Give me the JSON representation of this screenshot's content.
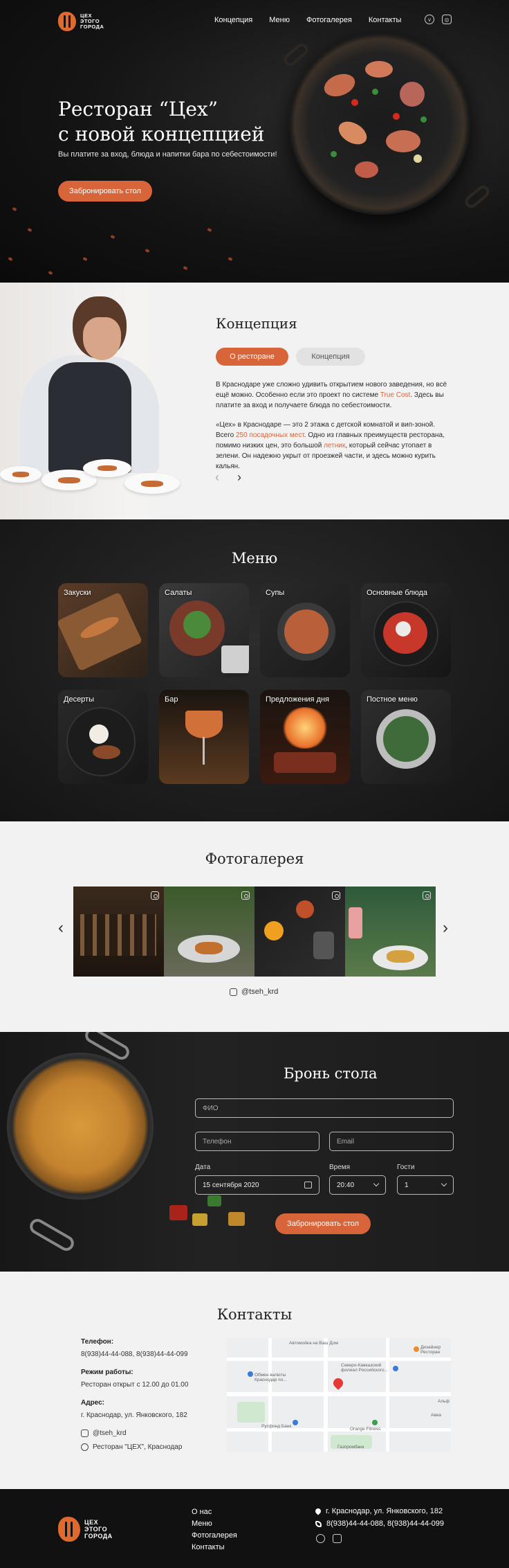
{
  "brand": {
    "logo_lines": [
      "ЦЕХ",
      "ЭТОГО",
      "ГОРОДА"
    ]
  },
  "nav": {
    "items": [
      "Концепция",
      "Меню",
      "Фотогалерея",
      "Контакты"
    ]
  },
  "social": {
    "icons": [
      "vk-icon",
      "instagram-icon"
    ]
  },
  "hero": {
    "title_line1": "Ресторан “Цех”",
    "title_line2": "с новой концепцией",
    "subtitle": "Вы платите за вход, блюда и напитки бара по себестоимости!",
    "cta": "Забронировать стол"
  },
  "concept": {
    "title": "Концепция",
    "tabs": [
      {
        "label": "О ресторане",
        "active": true
      },
      {
        "label": "Концепция",
        "active": false
      }
    ],
    "p1_a": "В Краснодаре уже сложно удивить открытием нового заведения, но всё ещё можно. Особенно если это проект по системе ",
    "p1_hl": "True Cost",
    "p1_b": ". Здесь вы платите за вход и получаете блюда по себестоимости.",
    "p2_a": "«Цех» в Краснодаре — это 2 этажа с детской комнатой и вип-зоной. Всего ",
    "p2_hl1": "250 посадочных мест",
    "p2_b": ". Одно из главных преимуществ ресторана, помимо низких цен, это большой ",
    "p2_hl2": "летник",
    "p2_c": ", который сейчас утопает в зелени. Он надежно укрыт от проезжей части, и здесь можно курить кальян.",
    "prev": "‹",
    "next": "›"
  },
  "menu": {
    "title": "Меню",
    "categories": [
      "Закуски",
      "Салаты",
      "Супы",
      "Основные блюда",
      "Десерты",
      "Бар",
      "Предложения дня",
      "Постное меню"
    ]
  },
  "gallery": {
    "title": "Фотогалерея",
    "prev": "‹",
    "next": "›",
    "handle": "@tseh_krd"
  },
  "booking": {
    "title": "Бронь стола",
    "name_placeholder": "ФИО",
    "phone_placeholder": "Телефон",
    "email_placeholder": "Email",
    "date_label": "Дата",
    "time_label": "Время",
    "guests_label": "Гости",
    "date_value": "15 сентября 2020",
    "time_value": "20:40",
    "guests_value": "1",
    "cta": "Забронировать стол"
  },
  "contacts": {
    "title": "Контакты",
    "phone_label": "Телефон:",
    "phone_value": "8(938)44-44-088, 8(938)44-44-099",
    "hours_label": "Режим работы:",
    "hours_value": "Ресторан открыт с 12.00 до 01.00",
    "address_label": "Адрес:",
    "address_value": "г. Краснодар, ул. Янковского, 182",
    "instagram": "@tseh_krd",
    "vk": "Ресторан \"ЦЕХ\", Краснодар",
    "map_labels": [
      "Автомойка на Ваш Дом",
      "Дизайнер Ресторан",
      "Северо-Кавказский филиал Российского...",
      "Обмен валюты Краснодар по...",
      "Альф",
      "Русфонд Банк",
      "Orange Fitness",
      "Газпромбанк",
      "Авиа"
    ]
  },
  "footer": {
    "links": [
      "О нас",
      "Меню",
      "Фотогалерея",
      "Контакты"
    ],
    "address": "г. Краснодар, ул. Янковского, 182",
    "phones": "8(938)44-44-088, 8(938)44-44-099"
  },
  "colors": {
    "accent": "#d8653a",
    "dark": "#141414",
    "light": "#f2f2f2"
  }
}
